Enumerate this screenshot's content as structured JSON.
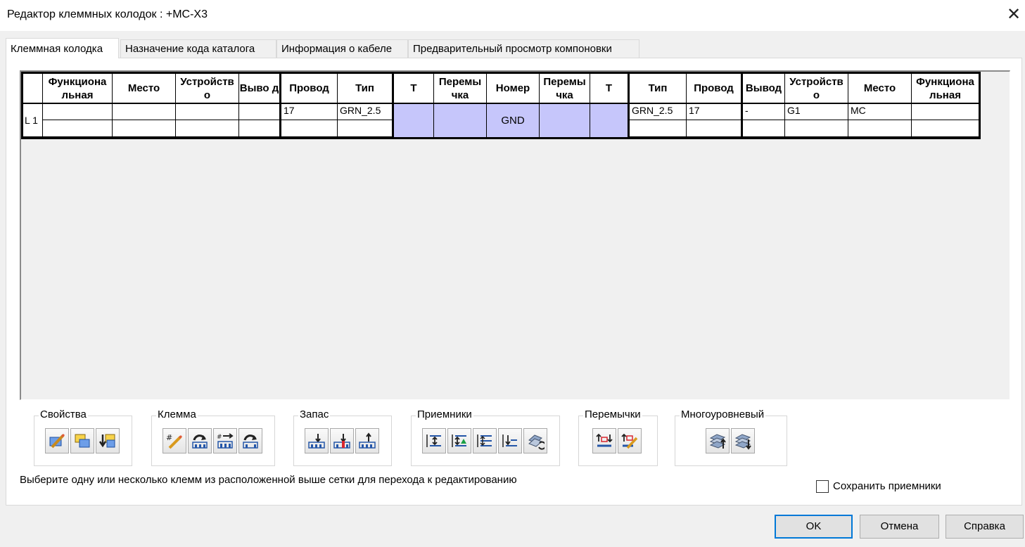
{
  "window": {
    "title": "Редактор клеммных колодок : +MC-X3",
    "close_glyph": "✕"
  },
  "tabs": [
    {
      "label": "Клеммная колодка",
      "active": true
    },
    {
      "label": "Назначение кода каталога",
      "active": false
    },
    {
      "label": "Информация о кабеле",
      "active": false
    },
    {
      "label": "Предварительный просмотр компоновки",
      "active": false
    }
  ],
  "grid": {
    "headers": [
      "Функциона льная",
      "Место",
      "Устройств о",
      "Выво д",
      "Провод",
      "Тип",
      "T",
      "Перемы чка",
      "Номер",
      "Перемы чка",
      "T",
      "Тип",
      "Провод",
      "Вывод",
      "Устройств о",
      "Место",
      "Функциона льная"
    ],
    "row_label": "L 1",
    "left": {
      "wire": "17",
      "type": "GRN_2.5"
    },
    "number": "GND",
    "right": {
      "type": "GRN_2.5",
      "wire": "17",
      "terminal": "-",
      "device": "G1",
      "location": "MC"
    },
    "jumper_color": "#c6c6fb"
  },
  "toolbar_groups": {
    "properties": "Свойства",
    "terminal": "Клемма",
    "spare": "Запас",
    "receivers": "Приемники",
    "jumpers": "Перемычки",
    "multilevel": "Многоуровневый"
  },
  "status_text": "Выберите одну или несколько клемм из расположенной выше сетки для перехода к редактированию",
  "save_receivers": {
    "label": "Сохранить приемники",
    "checked": false
  },
  "buttons": {
    "ok": "OK",
    "cancel": "Отмена",
    "help": "Справка"
  }
}
